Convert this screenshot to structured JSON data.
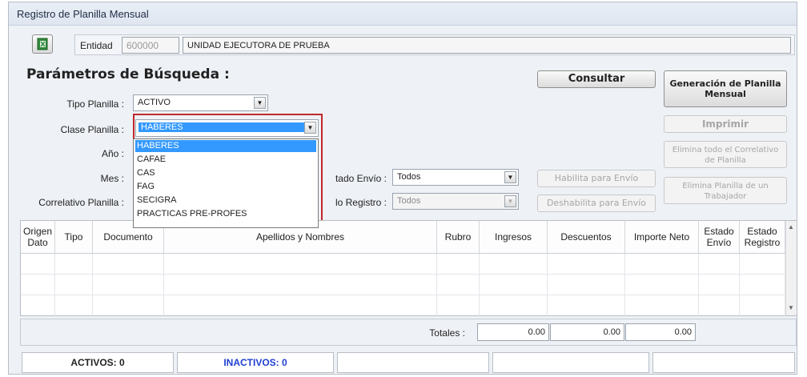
{
  "window": {
    "title": "Registro de Planilla Mensual"
  },
  "entity": {
    "label": "Entidad",
    "code": "600000",
    "name": "UNIDAD EJECUTORA DE PRUEBA"
  },
  "search": {
    "heading": "Parámetros de Búsqueda :",
    "tipo_label": "Tipo Planilla :",
    "tipo_value": "ACTIVO",
    "clase_label": "Clase Planilla :",
    "clase_value": "HABERES",
    "anio_label": "Año :",
    "mes_label": "Mes :",
    "correlativo_label": "Correlativo Planilla :",
    "estado_envio_label": "tado Envío :",
    "estado_envio_value": "Todos",
    "estado_registro_label": "lo Registro :",
    "estado_registro_value": "Todos"
  },
  "dropdown": {
    "options": [
      "HABERES",
      "CAFAE",
      "CAS",
      "FAG",
      "SECIGRA",
      "PRACTICAS PRE-PROFES"
    ],
    "selected_index": 0,
    "highlight_color": "#c0282d"
  },
  "buttons": {
    "consultar": "Consultar",
    "generacion": "Generación de Planilla Mensual",
    "imprimir": "Imprimir",
    "elimina_todo": "Elimina todo el Correlativo de Planilla",
    "habilita": "Habilita para Envío",
    "deshabilita": "Deshabilita para Envío",
    "elimina_trabajador": "Elimina Planilla de un Trabajador"
  },
  "table": {
    "columns": [
      "Origen Dato",
      "Tipo",
      "Documento",
      "Apellidos y Nombres",
      "Rubro",
      "Ingresos",
      "Descuentos",
      "Importe Neto",
      "Estado Envío",
      "Estado Registro"
    ],
    "rows": []
  },
  "totals": {
    "label": "Totales :",
    "ingresos": "0.00",
    "descuentos": "0.00",
    "importe_neto": "0.00"
  },
  "status": {
    "activos": "ACTIVOS: 0",
    "inactivos": "INACTIVOS: 0",
    "inactivos_color": "#1f3fd1"
  }
}
